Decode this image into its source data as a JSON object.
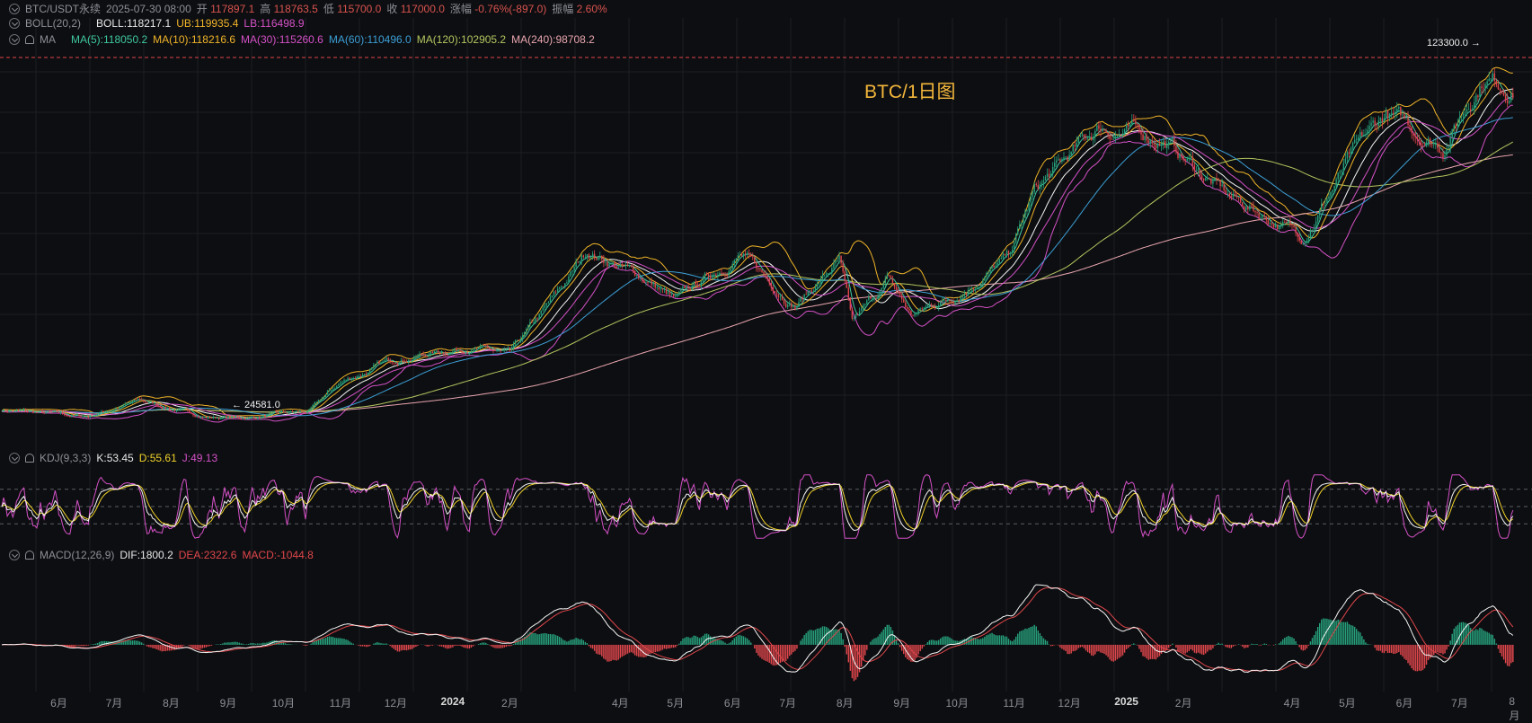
{
  "header": {
    "line1": {
      "symbol": "BTC/USDT永续",
      "datetime": "2025-07-30 08:00",
      "open_label": "开",
      "open": "117897.1",
      "high_label": "高",
      "high": "118763.5",
      "low_label": "低",
      "low": "115700.0",
      "close_label": "收",
      "close": "117000.0",
      "change_label": "涨幅",
      "change": "-0.76%(-897.0)",
      "amp_label": "振幅",
      "amp": "2.60%"
    },
    "boll": {
      "name": "BOLL(20,2)",
      "mid": "BOLL:118217.1",
      "ub": "UB:119935.4",
      "lb": "LB:116498.9"
    },
    "ma": {
      "name": "MA",
      "ma5": "MA(5):118050.2",
      "ma10": "MA(10):118216.6",
      "ma30": "MA(30):115260.6",
      "ma60": "MA(60):110496.0",
      "ma120": "MA(120):102905.2",
      "ma240": "MA(240):98708.2"
    },
    "kdj": {
      "name": "KDJ(9,3,3)",
      "k": "K:53.45",
      "d": "D:55.61",
      "j": "J:49.13"
    },
    "macd": {
      "name": "MACD(12,26,9)",
      "dif": "DIF:1800.2",
      "dea": "DEA:2322.6",
      "macd": "MACD:-1044.8"
    }
  },
  "chart_title": "BTC/1日图",
  "annotations": {
    "high": "123300.0 →",
    "low": "← 24581.0"
  },
  "colors": {
    "bg": "#0d0e11",
    "grid": "#1c1e23",
    "up": "#26a17b",
    "down": "#e0474c",
    "ma5": "#3ec8a0",
    "ma10": "#f0b429",
    "ma30": "#d451c7",
    "ma60": "#3b9fd6",
    "ma120": "#b3c65f",
    "ma240": "#e9a6b0",
    "boll": "#f5f5f5",
    "ub": "#f0b429",
    "lb": "#d451c7",
    "k": "#f5f5f5",
    "d": "#f0d22a",
    "j": "#d451c7",
    "dif": "#f5f5f5",
    "dea": "#e0474c"
  },
  "chart_data": {
    "type": "candlestick-with-indicators",
    "title": "BTC/1日图",
    "x_axis_ticks": [
      "6月",
      "7月",
      "8月",
      "9月",
      "10月",
      "11月",
      "12月",
      "2024",
      "2月",
      "4月",
      "5月",
      "6月",
      "7月",
      "8月",
      "9月",
      "10月",
      "11月",
      "12月",
      "2025",
      "2月",
      "4月",
      "5月",
      "6月",
      "7月",
      "8月"
    ],
    "price_keypoints": {
      "x": [
        "2023-05-01",
        "2023-06-15",
        "2023-07-15",
        "2023-08-20",
        "2023-09-10",
        "2023-10-15",
        "2023-11-01",
        "2023-12-01",
        "2024-01-10",
        "2024-02-01",
        "2024-03-01",
        "2024-03-14",
        "2024-04-15",
        "2024-05-01",
        "2024-06-05",
        "2024-07-05",
        "2024-07-29",
        "2024-08-05",
        "2024-08-25",
        "2024-09-06",
        "2024-10-01",
        "2024-10-29",
        "2024-11-12",
        "2024-12-17",
        "2025-01-20",
        "2025-02-25",
        "2025-04-07",
        "2025-05-01",
        "2025-05-22",
        "2025-06-22",
        "2025-07-14",
        "2025-07-30"
      ],
      "y": [
        28000,
        26000,
        30500,
        26000,
        25800,
        27500,
        35500,
        42000,
        45500,
        43000,
        62000,
        72000,
        64000,
        58000,
        71000,
        57000,
        69000,
        51500,
        64000,
        54000,
        60000,
        70000,
        88000,
        106000,
        103000,
        87000,
        76000,
        96000,
        109500,
        101000,
        120500,
        117000
      ]
    },
    "annotated_high": 123300.0,
    "annotated_low": 24581.0,
    "kdj_range": [
      0,
      100
    ],
    "kdj_levels": [
      20,
      50,
      80
    ],
    "macd_range": [
      -4500,
      7000
    ],
    "current": {
      "open": 117897.1,
      "high": 118763.5,
      "low": 115700.0,
      "close": 117000.0
    }
  }
}
